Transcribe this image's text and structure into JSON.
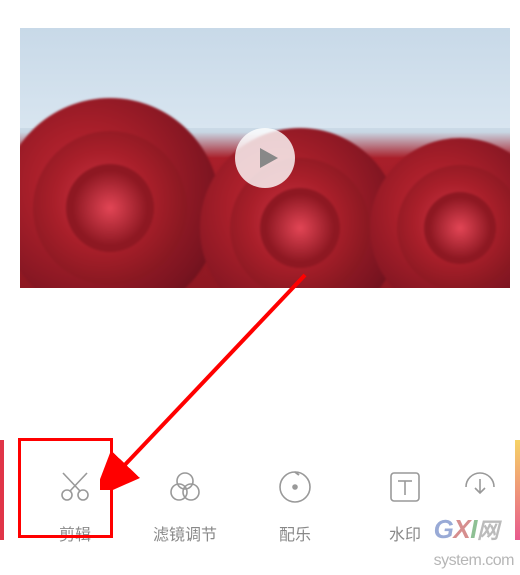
{
  "video": {
    "play_icon": "play-icon"
  },
  "toolbar": {
    "items": [
      {
        "icon": "scissors-icon",
        "label": "剪辑"
      },
      {
        "icon": "filter-icon",
        "label": "滤镜调节"
      },
      {
        "icon": "music-icon",
        "label": "配乐"
      },
      {
        "icon": "text-icon",
        "label": "水印"
      },
      {
        "icon": "more-icon",
        "label": ""
      }
    ]
  },
  "annotation": {
    "highlight_target": "edit-tool",
    "highlight_color": "#ff0000"
  },
  "watermark": {
    "brand_g": "G",
    "brand_x": "X",
    "brand_i": "I",
    "tail": "网",
    "domain": "system.com"
  }
}
